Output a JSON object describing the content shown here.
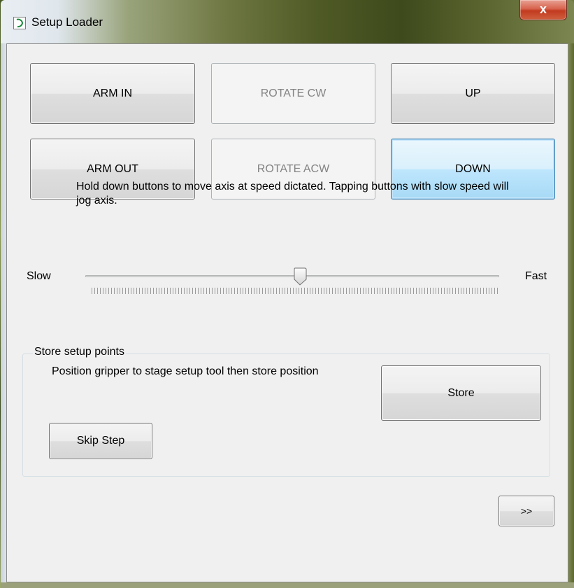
{
  "window": {
    "title": "Setup Loader",
    "close_label": "x"
  },
  "axis_buttons": {
    "arm_in": "ARM IN",
    "rotate_cw": "ROTATE CW",
    "up": "UP",
    "arm_out": "ARM OUT",
    "rotate_acw": "ROTATE ACW",
    "down": "DOWN"
  },
  "help_text": "Hold down buttons to move axis at speed dictated. Tapping buttons with slow speed will jog axis.",
  "speed": {
    "min_label": "Slow",
    "max_label": "Fast",
    "value_fraction": 0.52
  },
  "store_group": {
    "title": "Store setup points",
    "instruction": "Position gripper to stage setup tool then store position",
    "store_label": "Store",
    "skip_label": "Skip Step"
  },
  "next_label": ">>",
  "colors": {
    "focus_border": "#3c7fb1",
    "disabled_text": "#838383",
    "close_button": "#c23a1f"
  },
  "icons": {
    "app": "arc-logo-icon",
    "close": "close-icon",
    "slider_thumb": "slider-thumb-icon"
  }
}
